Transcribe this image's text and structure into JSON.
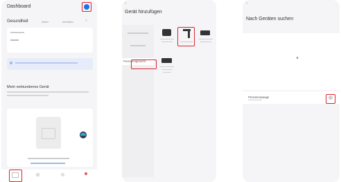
{
  "phone1": {
    "title": "Dashboard",
    "health_label": "Gesundheit",
    "health_tab_2": "Wetter",
    "health_tab_3": "Aktivitäten",
    "device_heading": "Mein verbundenes Gerät",
    "accent": "#1a73e8"
  },
  "phone2": {
    "title": "Gerät hinzufügen",
    "selected_category": "Personengewicht",
    "devices": [
      "Personengewicht",
      "Tracker",
      "Uhr",
      "Waage"
    ]
  },
  "phone3": {
    "title": "Nach Geräten suchen",
    "found_device": "Personenwaage"
  },
  "highlight_color": "#d9232e"
}
